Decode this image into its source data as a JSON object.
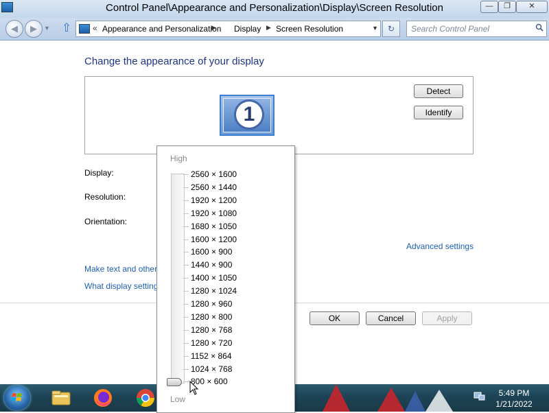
{
  "window": {
    "title": "Control Panel\\Appearance and Personalization\\Display\\Screen Resolution",
    "minimize_glyph": "—",
    "maximize_glyph": "❐",
    "close_glyph": "✕"
  },
  "nav": {
    "back_glyph": "◀",
    "forward_glyph": "▶",
    "breadcrumb": [
      "Appearance and Personalization",
      "Display",
      "Screen Resolution"
    ],
    "search_placeholder": "Search Control Panel"
  },
  "main": {
    "title": "Change the appearance of your display",
    "monitor_number": "1",
    "detect_label": "Detect",
    "identify_label": "Identify",
    "labels": {
      "display": "Display:",
      "resolution": "Resolution:",
      "orientation": "Orientation:"
    },
    "advanced_link": "Advanced settings",
    "link_text_size": "Make text and other items larger or smaller",
    "link_what_settings": "What display settings should I choose?",
    "ok_label": "OK",
    "cancel_label": "Cancel",
    "apply_label": "Apply"
  },
  "resolution_dropdown": {
    "high_label": "High",
    "low_label": "Low",
    "options": [
      "2560 × 1600",
      "2560 × 1440",
      "1920 × 1200",
      "1920 × 1080",
      "1680 × 1050",
      "1600 × 1200",
      "1600 × 900",
      "1440 × 900",
      "1400 × 1050",
      "1280 × 1024",
      "1280 × 960",
      "1280 × 800",
      "1280 × 768",
      "1280 × 720",
      "1152 × 864",
      "1024 × 768",
      "800 × 600"
    ],
    "selected": "800 × 600"
  },
  "taskbar": {
    "time": "5:49 PM",
    "date": "1/21/2022",
    "pinned": [
      "file-explorer",
      "firefox",
      "chrome"
    ]
  },
  "colors": {
    "title_blue": "#1e3287",
    "link_blue": "#1e5eb4",
    "taskbar": "#1d4355"
  }
}
